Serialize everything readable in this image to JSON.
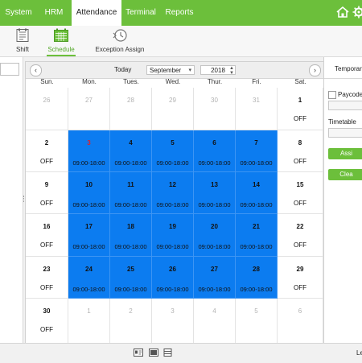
{
  "menu": {
    "items": [
      {
        "label": "System",
        "active": false
      },
      {
        "label": "HRM",
        "active": false
      },
      {
        "label": "Attendance",
        "active": true
      },
      {
        "label": "Terminal",
        "active": false
      },
      {
        "label": "Reports",
        "active": false
      }
    ]
  },
  "toolbar": {
    "items": [
      {
        "label": "Shift",
        "icon": "shift-icon",
        "active": false
      },
      {
        "label": "Schedule",
        "icon": "schedule-icon",
        "active": true
      },
      {
        "label": "Exception Assign",
        "icon": "exception-assign-icon",
        "active": false
      }
    ]
  },
  "calendar": {
    "today_label": "Today",
    "month": "September",
    "year": "2018",
    "weekdays": [
      "Sun.",
      "Mon.",
      "Tues.",
      "Wed.",
      "Thur.",
      "Fri.",
      "Sat."
    ],
    "schedule_color": "#0c7cf0",
    "weeks": [
      [
        {
          "day": "26",
          "sub": "",
          "other": true,
          "sched": false
        },
        {
          "day": "27",
          "sub": "",
          "other": true,
          "sched": false
        },
        {
          "day": "28",
          "sub": "",
          "other": true,
          "sched": false
        },
        {
          "day": "29",
          "sub": "",
          "other": true,
          "sched": false
        },
        {
          "day": "30",
          "sub": "",
          "other": true,
          "sched": false
        },
        {
          "day": "31",
          "sub": "",
          "other": true,
          "sched": false
        },
        {
          "day": "1",
          "sub": "OFF",
          "other": false,
          "sched": false
        }
      ],
      [
        {
          "day": "2",
          "sub": "OFF",
          "other": false,
          "sched": false
        },
        {
          "day": "3",
          "sub": "09:00-18:00",
          "other": false,
          "sched": true,
          "red": true
        },
        {
          "day": "4",
          "sub": "09:00-18:00",
          "other": false,
          "sched": true
        },
        {
          "day": "5",
          "sub": "09:00-18:00",
          "other": false,
          "sched": true
        },
        {
          "day": "6",
          "sub": "09:00-18:00",
          "other": false,
          "sched": true
        },
        {
          "day": "7",
          "sub": "09:00-18:00",
          "other": false,
          "sched": true
        },
        {
          "day": "8",
          "sub": "OFF",
          "other": false,
          "sched": false
        }
      ],
      [
        {
          "day": "9",
          "sub": "OFF",
          "other": false,
          "sched": false
        },
        {
          "day": "10",
          "sub": "09:00-18:00",
          "other": false,
          "sched": true
        },
        {
          "day": "11",
          "sub": "09:00-18:00",
          "other": false,
          "sched": true
        },
        {
          "day": "12",
          "sub": "09:00-18:00",
          "other": false,
          "sched": true
        },
        {
          "day": "13",
          "sub": "09:00-18:00",
          "other": false,
          "sched": true
        },
        {
          "day": "14",
          "sub": "09:00-18:00",
          "other": false,
          "sched": true
        },
        {
          "day": "15",
          "sub": "OFF",
          "other": false,
          "sched": false
        }
      ],
      [
        {
          "day": "16",
          "sub": "OFF",
          "other": false,
          "sched": false
        },
        {
          "day": "17",
          "sub": "09:00-18:00",
          "other": false,
          "sched": true
        },
        {
          "day": "18",
          "sub": "09:00-18:00",
          "other": false,
          "sched": true
        },
        {
          "day": "19",
          "sub": "09:00-18:00",
          "other": false,
          "sched": true
        },
        {
          "day": "20",
          "sub": "09:00-18:00",
          "other": false,
          "sched": true
        },
        {
          "day": "21",
          "sub": "09:00-18:00",
          "other": false,
          "sched": true
        },
        {
          "day": "22",
          "sub": "OFF",
          "other": false,
          "sched": false
        }
      ],
      [
        {
          "day": "23",
          "sub": "OFF",
          "other": false,
          "sched": false
        },
        {
          "day": "24",
          "sub": "09:00-18:00",
          "other": false,
          "sched": true
        },
        {
          "day": "25",
          "sub": "09:00-18:00",
          "other": false,
          "sched": true
        },
        {
          "day": "26",
          "sub": "09:00-18:00",
          "other": false,
          "sched": true
        },
        {
          "day": "27",
          "sub": "09:00-18:00",
          "other": false,
          "sched": true
        },
        {
          "day": "28",
          "sub": "09:00-18:00",
          "other": false,
          "sched": true
        },
        {
          "day": "29",
          "sub": "OFF",
          "other": false,
          "sched": false
        }
      ],
      [
        {
          "day": "30",
          "sub": "OFF",
          "other": false,
          "sched": false
        },
        {
          "day": "1",
          "sub": "",
          "other": true,
          "sched": false
        },
        {
          "day": "2",
          "sub": "",
          "other": true,
          "sched": false
        },
        {
          "day": "3",
          "sub": "",
          "other": true,
          "sched": false
        },
        {
          "day": "4",
          "sub": "",
          "other": true,
          "sched": false
        },
        {
          "day": "5",
          "sub": "",
          "other": true,
          "sched": false
        },
        {
          "day": "6",
          "sub": "",
          "other": true,
          "sched": false
        }
      ]
    ]
  },
  "right_panel": {
    "title": "Temporary",
    "paycode_label": "Paycode",
    "timetable_label": "Timetable",
    "assign_label": "Assi",
    "clear_label": "Clea"
  },
  "status": {
    "text": "Le"
  }
}
